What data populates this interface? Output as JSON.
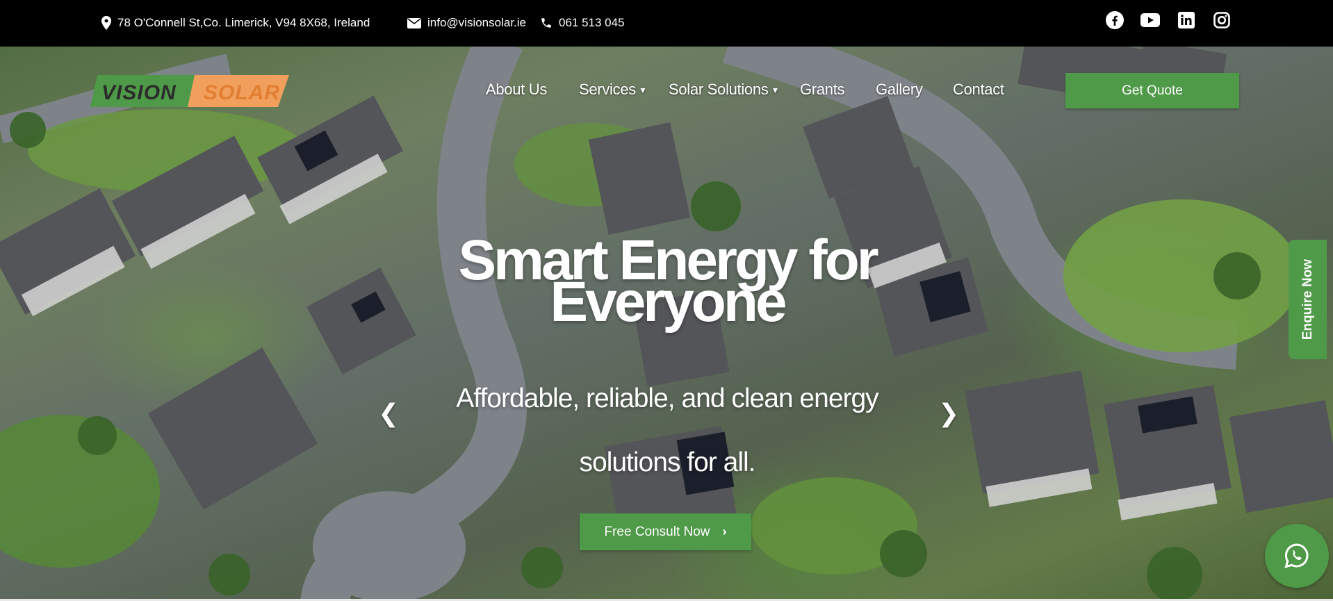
{
  "topbar": {
    "address": "78 O'Connell St,Co. Limerick, V94 8X68, Ireland",
    "email": "info@visionsolar.ie",
    "phone": "061 513 045",
    "address_icon": "map-pin-icon",
    "email_icon": "envelope-icon",
    "phone_icon": "phone-icon",
    "social": [
      "facebook-icon",
      "youtube-icon",
      "linkedin-icon",
      "instagram-icon"
    ]
  },
  "logo": {
    "word1": "VISION",
    "word2": "SOLAR",
    "green": "#4f9a48",
    "orange": "#f0a05c"
  },
  "nav": {
    "about": "About Us",
    "services": "Services",
    "solutions": "Solar Solutions",
    "grants": "Grants",
    "gallery": "Gallery",
    "contact": "Contact",
    "quote": "Get Quote"
  },
  "hero": {
    "title_line1": "Smart Energy for",
    "title_line2": "Everyone",
    "subtitle_line1": "Affordable, reliable, and clean energy",
    "subtitle_line2": "solutions for all.",
    "cta": "Free Consult Now",
    "prev": "❮",
    "next": "❯"
  },
  "widgets": {
    "enquire": "Enquire Now",
    "whatsapp_icon": "whatsapp-icon"
  },
  "colors": {
    "accent": "#4f9a48",
    "topbar": "#000000"
  }
}
